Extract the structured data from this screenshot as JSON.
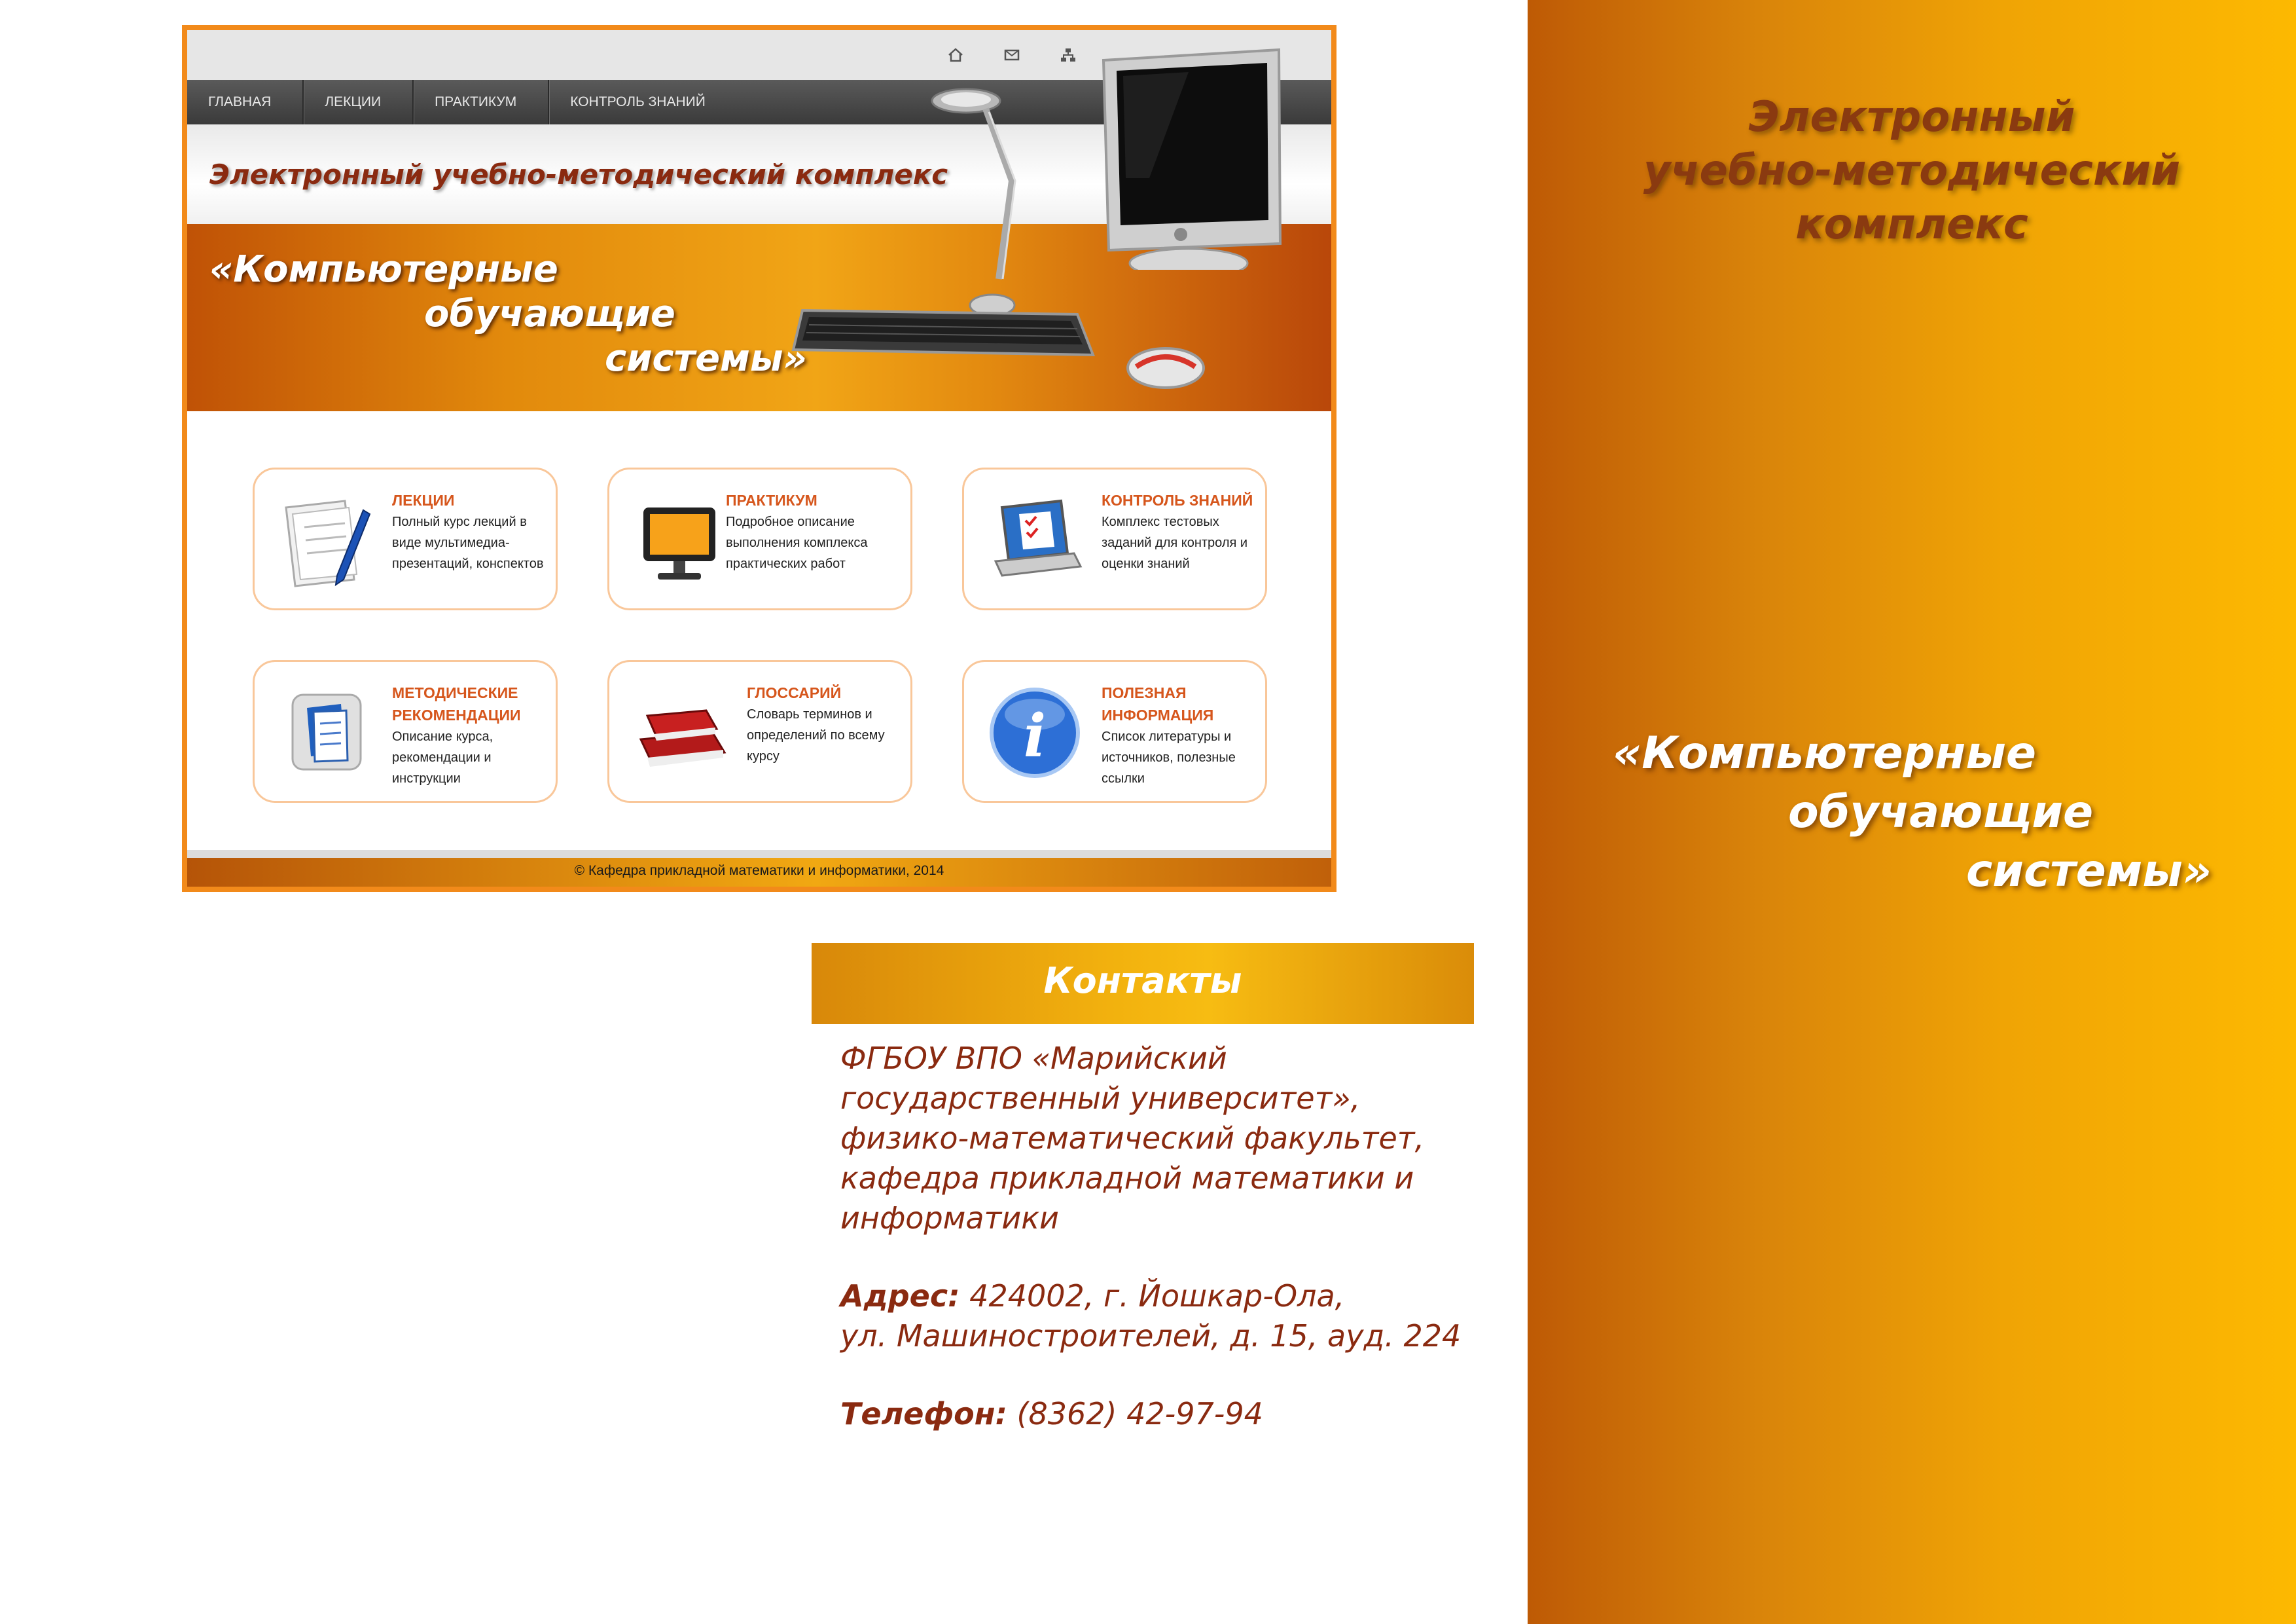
{
  "site": {
    "top_icons": [
      "home-icon",
      "mail-icon",
      "sitemap-icon"
    ],
    "nav": [
      "ГЛАВНАЯ",
      "ЛЕКЦИИ",
      "ПРАКТИКУМ",
      "КОНТРОЛЬ ЗНАНИЙ"
    ],
    "header_title": "Электронный учебно-методический комплекс",
    "banner": [
      "«Компьютерные",
      "обучающие",
      "системы»"
    ],
    "cards": [
      {
        "title": "ЛЕКЦИИ",
        "desc": "Полный курс лекций в виде мультимедиа-презентаций, конспектов",
        "icon": "lecture-notes-icon"
      },
      {
        "title": "ПРАКТИКУМ",
        "desc": "Подробное описание выполнения комплекса практических работ",
        "icon": "monitor-icon"
      },
      {
        "title": "КОНТРОЛЬ ЗНАНИЙ",
        "desc": "Комплекс тестовых заданий для контроля и оценки знаний",
        "icon": "laptop-test-icon"
      },
      {
        "title": "МЕТОДИЧЕСКИЕ РЕКОМЕНДАЦИИ",
        "desc": "Описание курса, рекомендации и инструкции",
        "icon": "documents-icon"
      },
      {
        "title": "ГЛОССАРИЙ",
        "desc": "Словарь терминов и определений по всему курсу",
        "icon": "books-icon"
      },
      {
        "title": "ПОЛЕЗНАЯ ИНФОРМАЦИЯ",
        "desc": "Список литературы и источников, полезные ссылки",
        "icon": "info-icon"
      }
    ],
    "footer": "© Кафедра прикладной математики и информатики, 2014"
  },
  "contacts": {
    "heading": "Контакты",
    "org": [
      "ФГБОУ ВПО «Марийский",
      "государственный университет»,",
      "физико-математический факультет,",
      "кафедра прикладной математики и",
      "информатики"
    ],
    "address_label": "Адрес:",
    "address_line1": "424002, г. Йошкар-Ола,",
    "address_line2": "ул. Машиностроителей, д. 15, ауд. 224",
    "phone_label": "Телефон:",
    "phone": "(8362) 42-97-94"
  },
  "right_panel": {
    "title": [
      "Электронный",
      "учебно-методический",
      "комплекс"
    ],
    "subtitle": [
      "«Компьютерные",
      "обучающие",
      "системы»"
    ]
  },
  "colors": {
    "accent_orange": "#f28a1a",
    "title_brown": "#8a2a10",
    "card_title": "#d6561c"
  }
}
